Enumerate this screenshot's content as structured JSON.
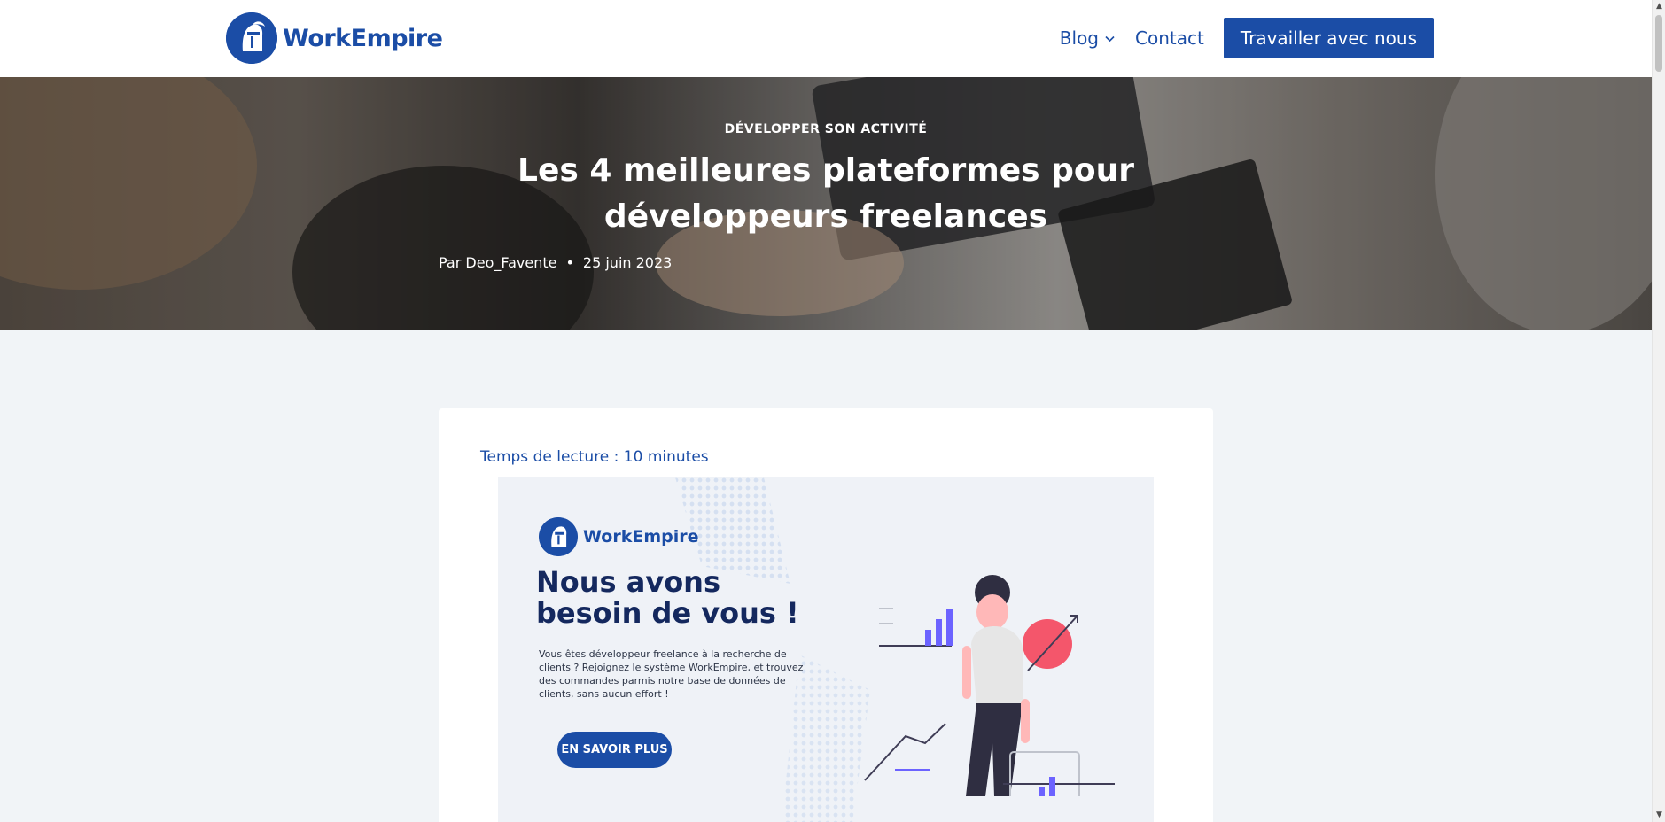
{
  "header": {
    "logo_text": "WorkEmpire",
    "nav": {
      "blog_label": "Blog",
      "contact_label": "Contact",
      "cta_label": "Travailler avec nous"
    }
  },
  "hero": {
    "category": "DÉVELOPPER SON ACTIVITÉ",
    "title": "Les 4 meilleures plateformes pour développeurs freelances",
    "author": "Par Deo_Favente",
    "separator": "•",
    "date": "25 juin 2023"
  },
  "article": {
    "reading_time": "Temps de lecture : 10 minutes",
    "banner": {
      "logo_text": "WorkEmpire",
      "headline": "Nous avons besoin de vous !",
      "body": "Vous êtes développeur freelance à la recherche de clients ? Rejoignez le système WorkEmpire, et trouvez des commandes parmis notre base de données de clients, sans aucun effort !",
      "button_label": "EN SAVOIR PLUS"
    }
  },
  "colors": {
    "brand": "#1b4da6",
    "page_bg": "#f1f4f7",
    "headline_dark": "#14285e",
    "accent_pink": "#f4566b",
    "accent_purple": "#6c63ff"
  },
  "icons": [
    "helmet-logo-icon",
    "chevron-down-icon",
    "person-illustration",
    "bar-chart-icon"
  ]
}
